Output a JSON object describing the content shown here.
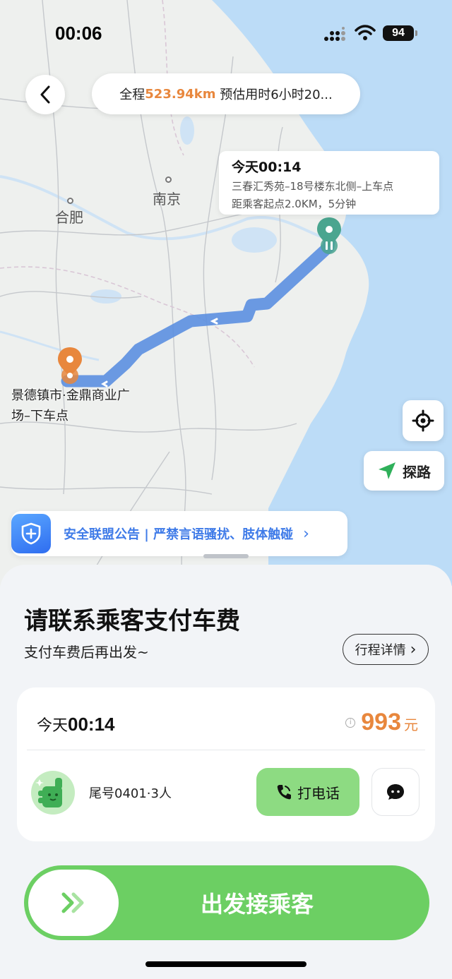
{
  "status_bar": {
    "time": "00:06",
    "battery": "94"
  },
  "map": {
    "cities": {
      "nanjing": "南京",
      "hefei": "合肥"
    },
    "summary": {
      "prefix": "全程",
      "distance": "523.94km",
      "suffix": " 预估用时6小时20..."
    },
    "pickup_callout": {
      "time": "今天00:14",
      "address": "三春汇秀苑–18号楼东北侧–上车点",
      "distance_info": "距乘客起点2.0KM，5分钟"
    },
    "dropoff_label": "景德镇市·金鼎商业广场–下车点",
    "explore_label": "探路",
    "safety_notice": "安全联盟公告 | 严禁言语骚扰、肢体触碰"
  },
  "sheet": {
    "title": "请联系乘客支付车费",
    "subtitle": "支付车费后再出发~",
    "detail_button": "行程详情",
    "order": {
      "day": "今天",
      "time": "00:14",
      "price": "993",
      "price_unit": "元",
      "passenger": "尾号0401·3人",
      "call_button": "打电话"
    },
    "slide_button": "出发接乘客"
  },
  "colors": {
    "accent_orange": "#e8873d",
    "accent_green": "#6ccf63",
    "route_blue": "#5b8fe0",
    "safety_blue": "#3f7be8"
  },
  "icons": [
    "back-arrow-icon",
    "signal-icon",
    "wifi-icon",
    "pickup-pin-icon",
    "dropoff-pin-icon",
    "locate-icon",
    "navigate-arrow-icon",
    "shield-icon",
    "chevron-right-icon",
    "info-icon",
    "phone-icon",
    "chat-icon",
    "double-chevron-icon"
  ]
}
